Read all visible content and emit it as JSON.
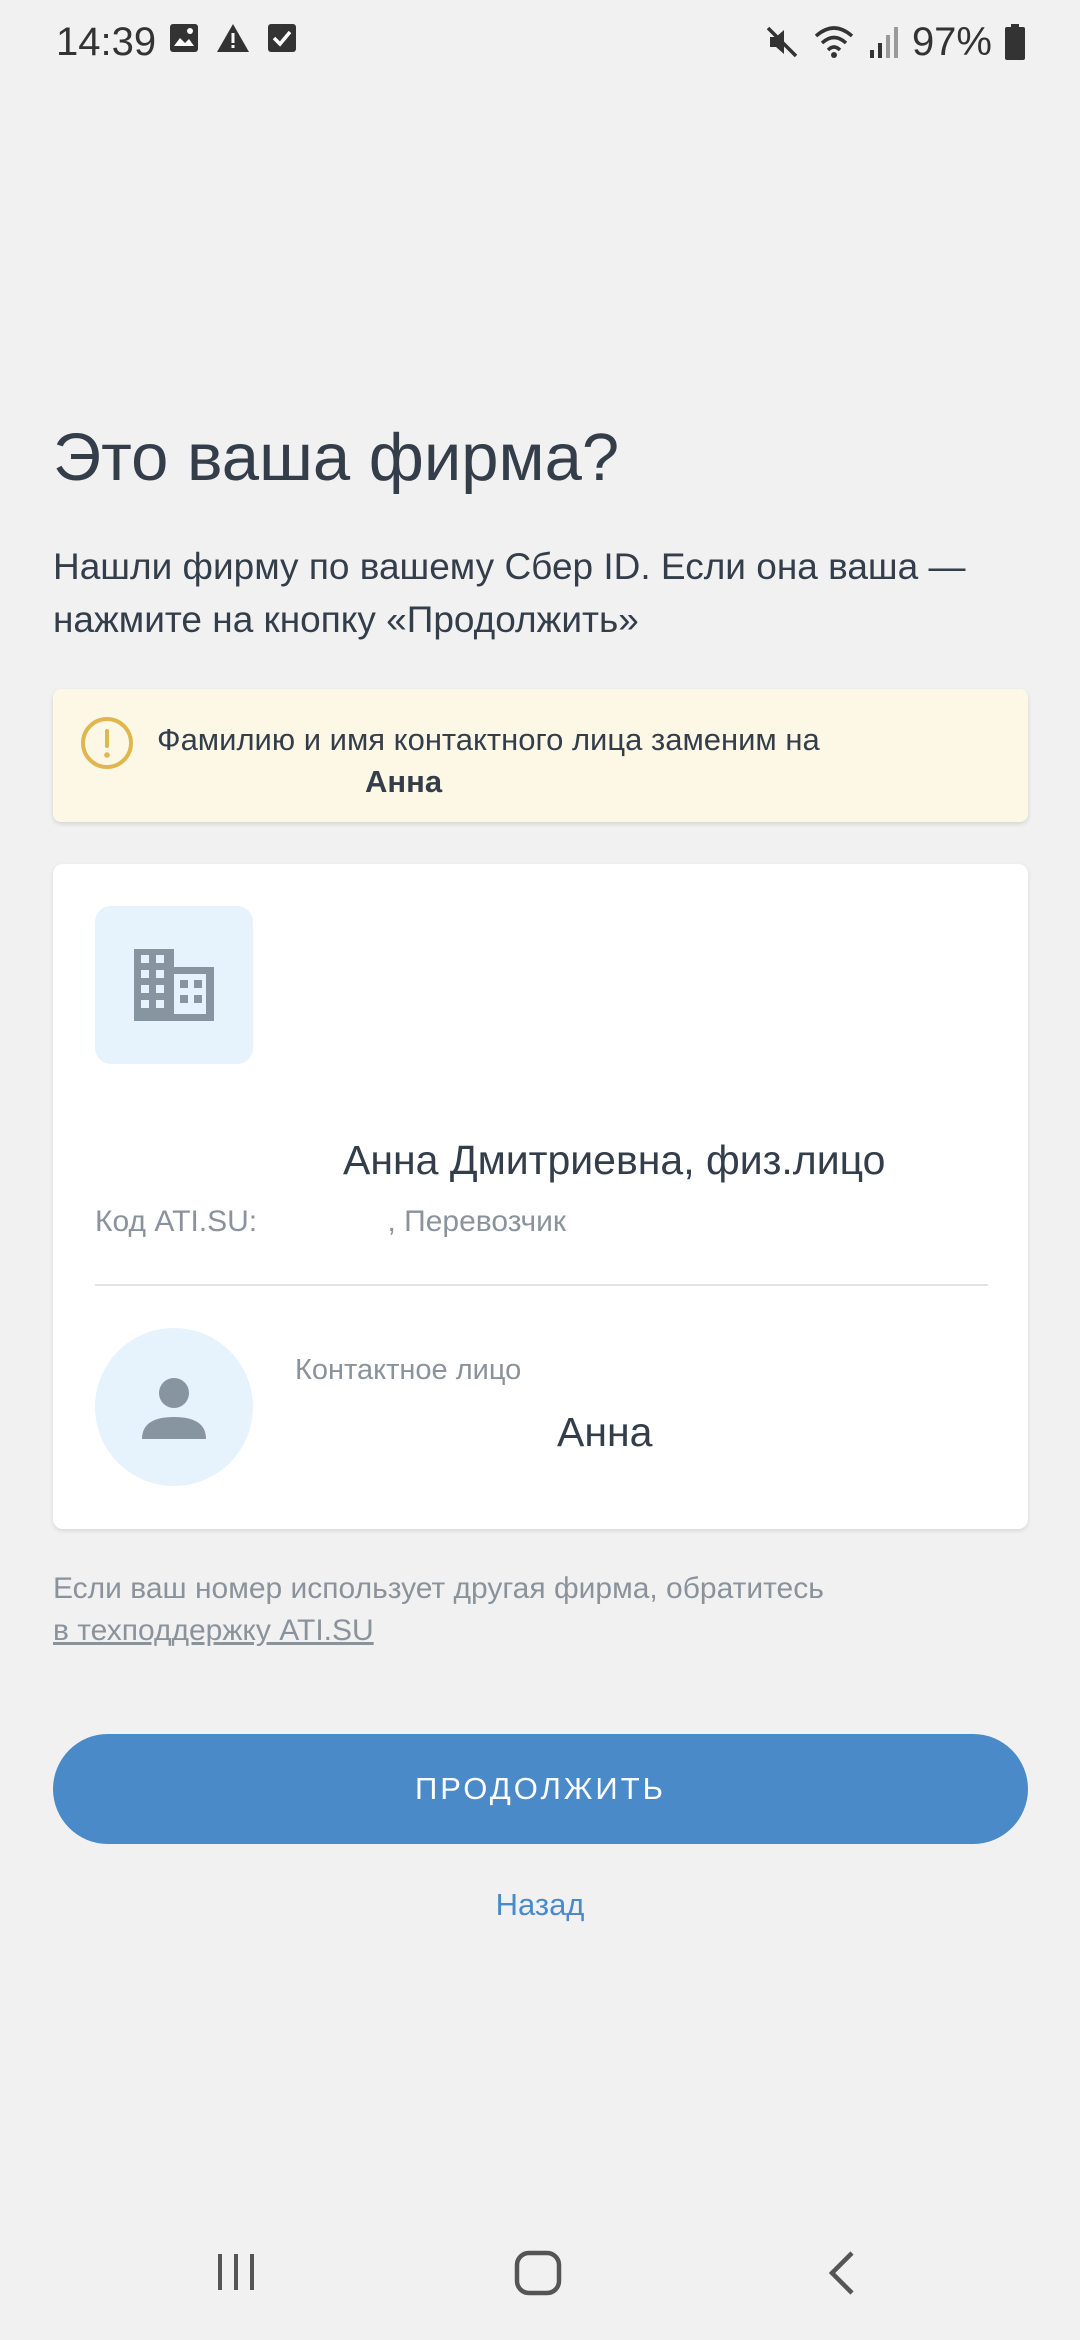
{
  "status_bar": {
    "time": "14:39",
    "left_icons": [
      "image-icon",
      "warning-icon",
      "checkbox-icon"
    ],
    "right_icons": [
      "mute-icon",
      "wifi-icon",
      "signal-icon",
      "battery-icon"
    ],
    "battery": "97%"
  },
  "title": "Это ваша фирма?",
  "subtitle": "Нашли фирму по вашему Сбер ID. Если она ваша — нажмите на кнопку «Продолжить»",
  "warning": {
    "text": "Фамилию и имя контактного лица заменим на",
    "name": "Анна",
    "accent": "#e0b74d",
    "background": "#fdf7e6"
  },
  "company": {
    "icon": "building-icon",
    "name_visible": "Анна Дмитриевна, физ.лицо",
    "code_label": "Код ATI.SU:",
    "role": ", Перевозчик"
  },
  "contact": {
    "icon": "person-icon",
    "label": "Контактное лицо",
    "name_visible": "Анна"
  },
  "support": {
    "text": "Если ваш номер использует другая фирма, обратитесь",
    "link": "в техподдержку ATI.SU"
  },
  "continue_button": "ПРОДОЛЖИТЬ",
  "back_link": "Назад",
  "colors": {
    "primary": "#4a8ac9",
    "background": "#f1f1f1",
    "card": "#ffffff",
    "text": "#343e4b",
    "muted": "#8a939c"
  },
  "nav": {
    "recents": "recents-icon",
    "home": "home-icon",
    "back": "back-icon"
  }
}
